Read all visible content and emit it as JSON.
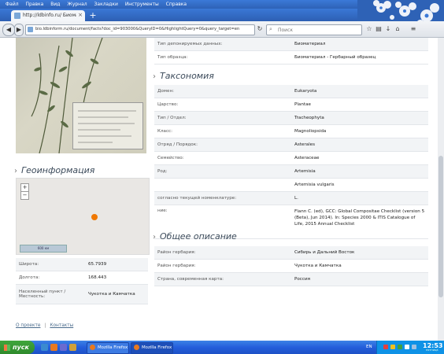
{
  "menubar": {
    "items": [
      "Файл",
      "Правка",
      "Вид",
      "Журнал",
      "Закладки",
      "Инструменты",
      "Справка"
    ]
  },
  "tab": {
    "title": "http://ldbinfo.ru/ Биоматериал",
    "close": "×",
    "new_tab": "+"
  },
  "nav": {
    "url": "bio.ldbinform.ru/document/facts?doc_id=903000&QueryID=0&HighlightQuery=0&query_target=en",
    "search_placeholder": "Поиск"
  },
  "geo": {
    "heading": "Геоинформация",
    "zoom_in": "+",
    "zoom_out": "−",
    "scale_label": "600 км",
    "rows": [
      {
        "k": "Широта:",
        "v": "65.7939"
      },
      {
        "k": "Долгота:",
        "v": "168.443"
      },
      {
        "k": "Населенный пункт / Местность:",
        "v": "Чукотка и Камчатка"
      }
    ]
  },
  "deposit": {
    "rows": [
      {
        "k": "Тип депонируемых данных:",
        "v": "Биоматериал"
      },
      {
        "k": "Тип образца:",
        "v": "Биоматериал - Гербарный образец"
      }
    ]
  },
  "taxonomy": {
    "heading": "Таксономия",
    "rows": [
      {
        "k": "Домен:",
        "v": "Eukaryota"
      },
      {
        "k": "Царство:",
        "v": "Plantae"
      },
      {
        "k": "Тип / Отдел:",
        "v": "Tracheophyta"
      },
      {
        "k": "Класс:",
        "v": "Magnoliopsida"
      },
      {
        "k": "Отряд / Порядок:",
        "v": "Asterales"
      },
      {
        "k": "Семейство:",
        "v": "Asteraceae"
      },
      {
        "k": "Род:",
        "v": "Artemisia"
      },
      {
        "k": "",
        "v": "Artemisia vulgaris"
      },
      {
        "k": "согласно текущей номенклатуре:",
        "v": "L."
      },
      {
        "k": "ние:",
        "v": "Flann C. (ed), GCC: Global Compositae Checklist (version 5 (Beta), Jun 2014). In: Species 2000 & ITIS Catalogue of Life, 2015 Annual Checklist"
      }
    ]
  },
  "general": {
    "heading": "Общее описание",
    "rows": [
      {
        "k": "Район гербария:",
        "v": "Сибирь и Дальний Восток"
      },
      {
        "k": "Район гербария:",
        "v": "Чукотка и Камчатка"
      },
      {
        "k": "Страна, современная карта:",
        "v": "Россия"
      }
    ]
  },
  "footer": {
    "about": "О проекте",
    "contacts": "Контакты"
  },
  "taskbar": {
    "start": "пуск",
    "buttons": [
      "Mozilla Firefox",
      "Mozilla Firefox"
    ],
    "lang": "EN",
    "clock": "12:53",
    "clock_sub": "пятница"
  },
  "colors": {
    "accent": "#f07800",
    "taskbar": "#245edb",
    "start": "#3fa63c"
  }
}
